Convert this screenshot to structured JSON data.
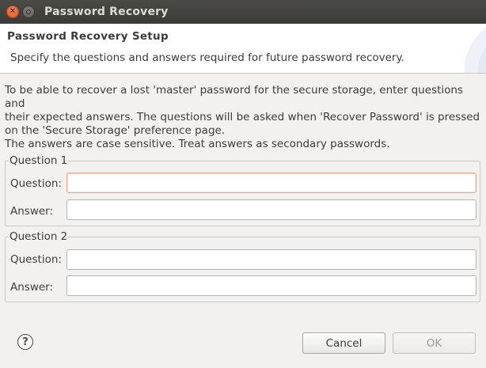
{
  "window": {
    "title": "Password Recovery"
  },
  "banner": {
    "title": "Password Recovery Setup",
    "description": "Specify the questions and answers required for future password recovery."
  },
  "intro": {
    "line1": "To be able to recover a lost 'master' password for the secure storage, enter questions and",
    "line2": "their expected answers. The questions will be asked when 'Recover Password' is pressed",
    "line3": "on the 'Secure Storage' preference page."
  },
  "note": "The answers are case sensitive. Treat answers as secondary passwords.",
  "groups": [
    {
      "label": "Question 1",
      "question_label": "Question:",
      "question_value": "",
      "answer_label": "Answer:",
      "answer_value": ""
    },
    {
      "label": "Question 2",
      "question_label": "Question:",
      "question_value": "",
      "answer_label": "Answer:",
      "answer_value": ""
    }
  ],
  "footer": {
    "help_icon": "?",
    "cancel_label": "Cancel",
    "ok_label": "OK"
  },
  "icons": {
    "close": "close-icon",
    "minimize": "minimize-icon",
    "help": "help-icon"
  },
  "colors": {
    "titlebar": "#3c3b37",
    "close_button": "#e0521e",
    "focus_border": "#f0a684",
    "disabled_text": "#9b9a98"
  }
}
